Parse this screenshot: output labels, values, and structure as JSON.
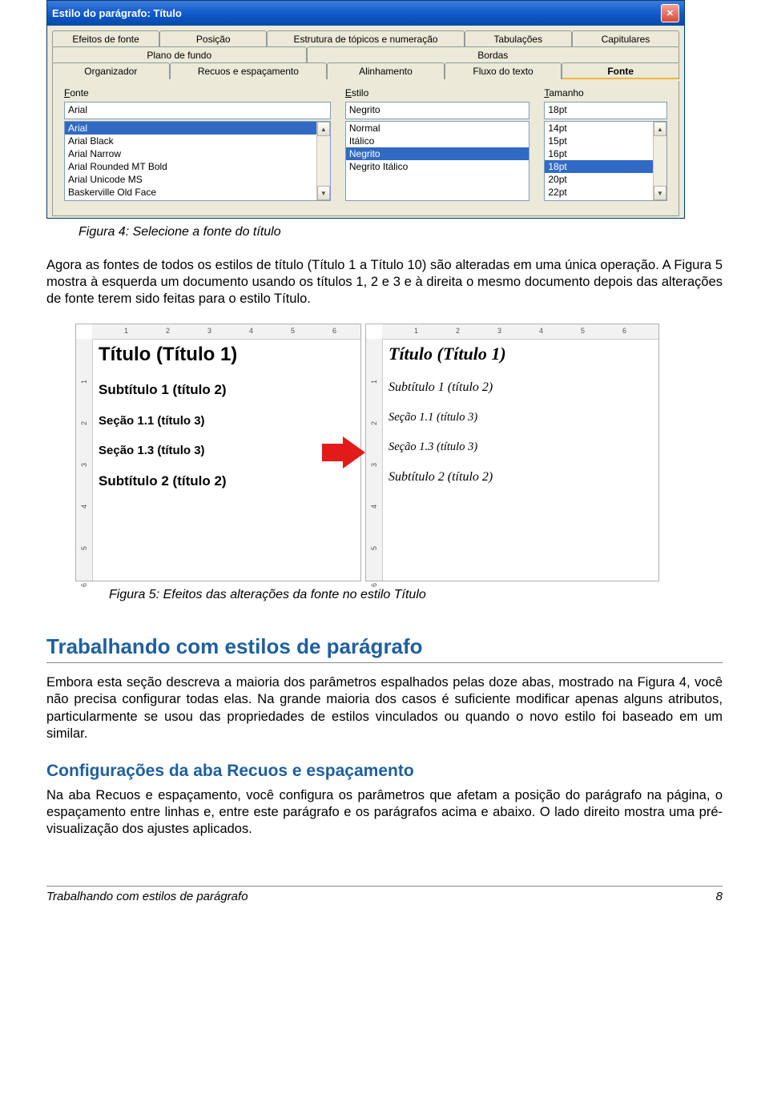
{
  "dialog": {
    "title": "Estilo do parágrafo: Título",
    "tabs_row1": [
      "Efeitos de fonte",
      "Posição",
      "Estrutura de tópicos e numeração",
      "Tabulações",
      "Capitulares"
    ],
    "tabs_row2": [
      "Plano de fundo",
      "Bordas"
    ],
    "tabs_row3": [
      "Organizador",
      "Recuos e espaçamento",
      "Alinhamento",
      "Fluxo do texto",
      "Fonte"
    ],
    "font_label": "Fonte",
    "style_label": "Estilo",
    "size_label": "Tamanho",
    "font_input": "Arial",
    "style_input": "Negrito",
    "size_input": "18pt",
    "font_list": [
      "Arial",
      "Arial Black",
      "Arial Narrow",
      "Arial Rounded MT Bold",
      "Arial Unicode MS",
      "Baskerville Old Face"
    ],
    "style_list": [
      "Normal",
      "Itálico",
      "Negrito",
      "Negrito Itálico"
    ],
    "size_list": [
      "14pt",
      "15pt",
      "16pt",
      "18pt",
      "20pt",
      "22pt"
    ]
  },
  "fig4_caption": "Figura 4: Selecione a fonte do título",
  "para1": "Agora as fontes de todos os estilos de título (Título 1 a Título 10) são alteradas em uma única operação. A Figura 5 mostra à esquerda um documento usando os títulos 1, 2 e 3 e à direita o mesmo documento depois das alterações de fonte terem sido feitas para o estilo Título.",
  "fig5": {
    "ruler_h": [
      "1",
      "2",
      "3",
      "4",
      "5",
      "6"
    ],
    "ruler_v": [
      "1",
      "2",
      "3",
      "4",
      "5",
      "6"
    ],
    "left": [
      "Título (Título 1)",
      "Subtítulo 1 (título 2)",
      "Seção 1.1 (título 3)",
      "Seção 1.3 (título 3)",
      "Subtítulo 2 (título 2)"
    ],
    "right": [
      "Título (Título 1)",
      "Subtítulo 1 (título 2)",
      "Seção 1.1 (título 3)",
      "Seção 1.3 (título 3)",
      "Subtítulo 2 (título 2)"
    ]
  },
  "fig5_caption": "Figura 5: Efeitos das alterações da fonte no estilo Título",
  "h1": "Trabalhando com estilos de parágrafo",
  "para2": "Embora esta seção descreva a maioria dos parâmetros espalhados pelas doze abas, mostrado na Figura 4, você não precisa configurar todas elas. Na grande maioria dos casos é suficiente modificar apenas alguns atributos, particularmente se usou das propriedades de estilos vinculados ou quando o novo estilo foi baseado em um similar.",
  "h2": "Configurações da aba Recuos e espaçamento",
  "para3": "Na aba Recuos e espaçamento, você configura os parâmetros que afetam a posição do parágrafo na página, o espaçamento entre linhas e, entre este parágrafo e os parágrafos acima e abaixo. O lado direito mostra uma pré-visualização dos ajustes aplicados.",
  "footer_left": "Trabalhando com estilos de parágrafo",
  "footer_right": "8"
}
